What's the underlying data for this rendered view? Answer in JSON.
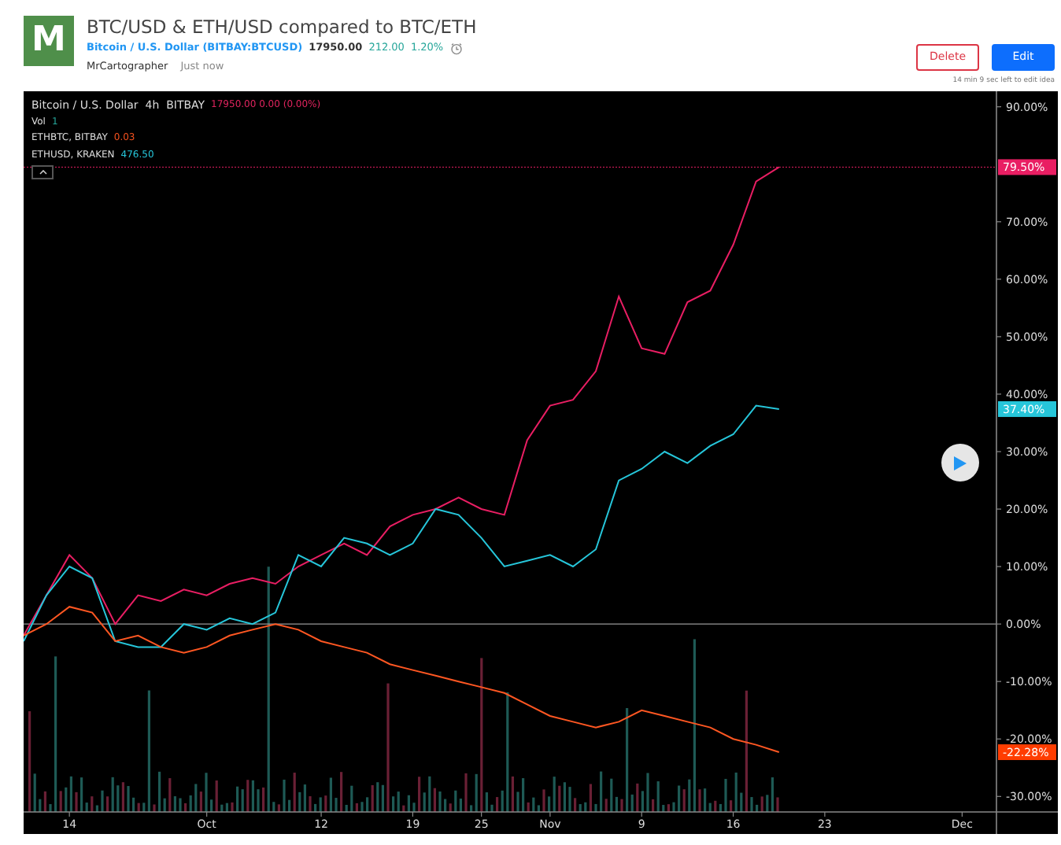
{
  "header": {
    "logo_letter": "M",
    "title": "BTC/USD & ETH/USD compared to BTC/ETH",
    "symbol_link": "Bitcoin / U.S. Dollar (BITBAY:BTCUSD)",
    "price": "17950.00",
    "change": "212.00",
    "change_percent": "1.20%",
    "author": "MrCartographer",
    "time": "Just now"
  },
  "actions": {
    "buttons": [
      {
        "label": "Delete",
        "kind": "outline-danger"
      },
      {
        "label": "Edit",
        "kind": "primary"
      }
    ],
    "note": "14 min 9 sec left to edit idea"
  },
  "chart": {
    "legend": [
      {
        "label": "Bitcoin / U.S. Dollar  4h  BITBAY",
        "values": "17950.00 0.00 (0.00%)",
        "color": "#e0245e"
      },
      {
        "label": "Vol",
        "values": "1",
        "color": "#26a69a"
      },
      {
        "label": "ETHBTC, BITBAY",
        "values": "0.03",
        "color": "#f4511e"
      },
      {
        "label": "ETHUSD, KRAKEN",
        "values": "476.50",
        "color": "#26c6da"
      }
    ],
    "price_tags": [
      {
        "text": "79.50%",
        "color": "#e91e63"
      },
      {
        "text": "37.40%",
        "color": "#26c6da"
      },
      {
        "text": "-22.28%",
        "color": "#ff3d00"
      }
    ],
    "chart_data": {
      "type": "line",
      "categories": [
        null,
        null,
        "14",
        null,
        null,
        null,
        null,
        null,
        "Oct",
        null,
        null,
        null,
        null,
        "12",
        null,
        null,
        null,
        "19",
        null,
        null,
        "25",
        null,
        null,
        "Nov",
        null,
        null,
        null,
        "9",
        null,
        null,
        null,
        "16",
        null,
        null,
        null,
        "23",
        null,
        null,
        null,
        null,
        null,
        "Dec"
      ],
      "ylim": [
        -32.7,
        92.7
      ],
      "yticks": [
        {
          "value": 90,
          "label": "90.00%"
        },
        {
          "value": 70,
          "label": "70.00%"
        },
        {
          "value": 60,
          "label": "60.00%"
        },
        {
          "value": 50,
          "label": "50.00%"
        },
        {
          "value": 40,
          "label": "40.00%"
        },
        {
          "value": 30,
          "label": "30.00%"
        },
        {
          "value": 20,
          "label": "20.00%"
        },
        {
          "value": 10,
          "label": "10.00%"
        },
        {
          "value": 0,
          "label": "0.00%"
        },
        {
          "value": -10,
          "label": "-10.00%"
        },
        {
          "value": -20,
          "label": "-20.00%"
        },
        {
          "value": -30,
          "label": "-30.00%"
        }
      ],
      "series": [
        {
          "color": "#e91e63",
          "values": [
            -2,
            5,
            12,
            8,
            0,
            5,
            4,
            6,
            5,
            7,
            8,
            7,
            10,
            12,
            14,
            12,
            17,
            19,
            20,
            22,
            20,
            19,
            32,
            38,
            39,
            44,
            57,
            48,
            47,
            56,
            58,
            66,
            77,
            79.5,
            null,
            null,
            null,
            null,
            null,
            null,
            null,
            null
          ]
        },
        {
          "color": "#26c6da",
          "values": [
            -3,
            5,
            10,
            8,
            -3,
            -4,
            -4,
            0,
            -1,
            1,
            0,
            2,
            12,
            10,
            15,
            14,
            12,
            14,
            20,
            19,
            15,
            10,
            11,
            12,
            10,
            13,
            25,
            27,
            30,
            28,
            31,
            33,
            38,
            37.4,
            null,
            null,
            null,
            null,
            null,
            null,
            null,
            null
          ]
        },
        {
          "color": "#ff5722",
          "values": [
            -2,
            0,
            3,
            2,
            -3,
            -2,
            -4,
            -5,
            -4,
            -2,
            -1,
            0,
            -1,
            -3,
            -4,
            -5,
            -7,
            -8,
            -9,
            -10,
            -11,
            -12,
            -14,
            -16,
            -17,
            -18,
            -17,
            -15,
            -16,
            -17,
            -18,
            -20,
            -21,
            -22.3,
            null,
            null,
            null,
            null,
            null,
            null,
            null,
            null
          ]
        }
      ]
    }
  }
}
